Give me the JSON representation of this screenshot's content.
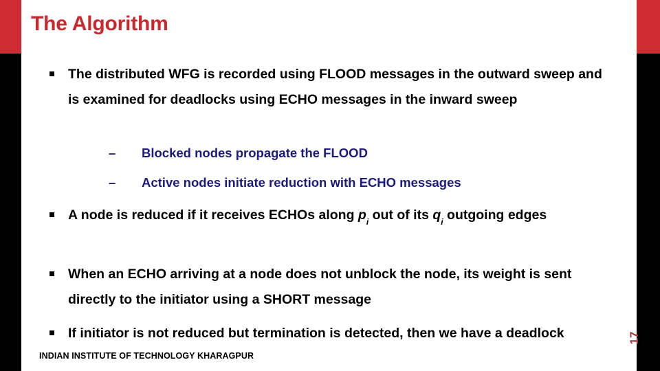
{
  "slide": {
    "title": "The Algorithm",
    "page_number": "17",
    "footer": "INDIAN INSTITUTE OF TECHNOLOGY KHARAGPUR",
    "colors": {
      "title_red": "#C9282D",
      "bar_red": "#CE2B32",
      "bar_black": "#000000",
      "subbullet_navy": "#1A1A80",
      "page_number_red": "#A03238",
      "background": "#FFFFFF"
    },
    "bullets": [
      {
        "level": 1,
        "marker": "square-bullet",
        "text": "The distributed WFG is recorded using FLOOD messages in the outward sweep and is examined for deadlocks using ECHO messages in the inward sweep"
      },
      {
        "level": 2,
        "marker": "dash-bullet",
        "text": "Blocked nodes propagate the FLOOD"
      },
      {
        "level": 2,
        "marker": "dash-bullet",
        "text": "Active nodes initiate reduction with ECHO messages"
      },
      {
        "level": 1,
        "marker": "square-bullet",
        "text_parts": {
          "part1": "A node is reduced if it receives ECHOs along ",
          "var1": "p",
          "var1_sub": "i",
          "part2": " out of its ",
          "var2": "q",
          "var2_sub": "i",
          "part3": " outgoing edges"
        }
      },
      {
        "level": 1,
        "marker": "square-bullet",
        "text": "When an ECHO arriving at a node does not unblock the node, its weight is sent directly to the initiator using a SHORT message"
      },
      {
        "level": 1,
        "marker": "square-bullet",
        "text": "If initiator is not reduced but termination is detected, then we have a deadlock"
      }
    ],
    "markers": {
      "dash": "–"
    }
  }
}
